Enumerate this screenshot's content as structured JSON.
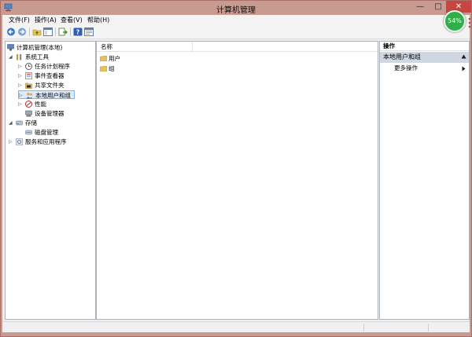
{
  "window": {
    "title": "计算机管理"
  },
  "badge": {
    "text": "54%"
  },
  "menu": [
    {
      "label": "文件(F)"
    },
    {
      "label": "操作(A)"
    },
    {
      "label": "查看(V)"
    },
    {
      "label": "帮助(H)"
    }
  ],
  "toolbar": [
    "back-icon",
    "forward-icon",
    "up-folder-icon",
    "show-hide-tree-icon",
    "export-list-icon",
    "help-icon",
    "properties-icon"
  ],
  "tree": {
    "root": "计算机管理(本地)",
    "system_tools": "系统工具",
    "task_scheduler": "任务计划程序",
    "event_viewer": "事件查看器",
    "shared_folders": "共享文件夹",
    "local_users_groups": "本地用户和组",
    "performance": "性能",
    "device_manager": "设备管理器",
    "storage": "存储",
    "disk_management": "磁盘管理",
    "services_apps": "服务和应用程序"
  },
  "list": {
    "column_name": "名称",
    "items": [
      {
        "label": "用户"
      },
      {
        "label": "组"
      }
    ]
  },
  "actions": {
    "header": "操作",
    "section": "本地用户和组",
    "more": "更多操作"
  },
  "colors": {
    "window_frame": "#c89a90",
    "close_button": "#c7463f",
    "selection": "#dcebfc",
    "actions_section": "#ced7e2",
    "badge": "#2fae4a"
  }
}
